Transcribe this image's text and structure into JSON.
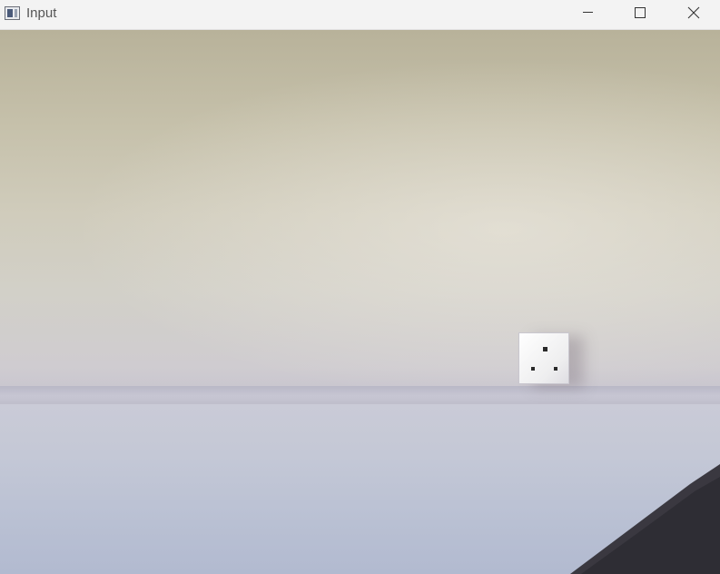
{
  "window": {
    "title": "Input"
  },
  "controls": {
    "minimize_icon": "minimize-icon",
    "maximize_icon": "maximize-icon",
    "close_icon": "close-icon"
  },
  "colors": {
    "titlebar_bg": "#f3f3f3",
    "title_text": "#555555"
  }
}
